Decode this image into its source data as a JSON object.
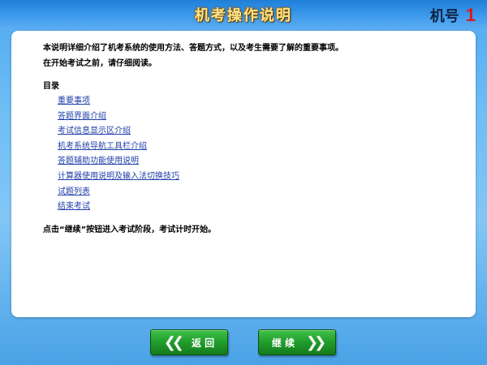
{
  "header": {
    "title": "机考操作说明",
    "machine_label": "机号",
    "machine_number": "1"
  },
  "content": {
    "intro_line1": "本说明详细介绍了机考系统的使用方法、答题方式，以及考生需要了解的重要事项。",
    "intro_line2": "在开始考试之前，请仔细阅读。",
    "toc_title": "目录",
    "toc_items": [
      "重要事项",
      "答题界面介绍",
      "考试信息显示区介绍",
      "机考系统导航工具栏介绍",
      "答题辅助功能使用说明",
      "计算器使用说明及输入法切换技巧",
      "试题列表",
      "结束考试"
    ],
    "outro": "点击“继续”按钮进入考试阶段，考试计时开始。"
  },
  "buttons": {
    "back_label": "返 回",
    "next_label": "继 续"
  },
  "colors": {
    "link": "#1f3fa8",
    "button_green": "#23a02e",
    "machine_number": "#e01616",
    "title_gold": "#ffe48a"
  }
}
